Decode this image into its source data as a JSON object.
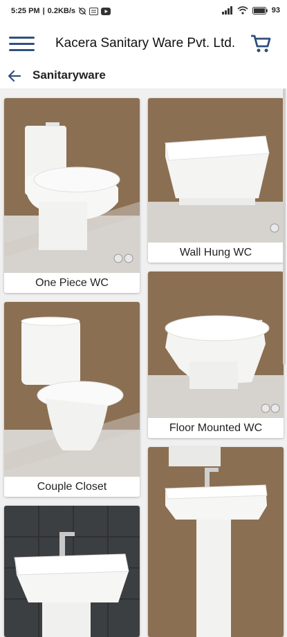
{
  "status": {
    "time": "5:25 PM",
    "speed": "0.2KB/s",
    "battery": "93"
  },
  "header": {
    "title": "Kacera Sanitary Ware Pvt. Ltd.",
    "menu_icon": "hamburger-menu-icon",
    "cart_icon": "shopping-cart-icon"
  },
  "subheader": {
    "title": "Sanitaryware",
    "back_icon": "back-arrow-icon"
  },
  "products": [
    {
      "name": "One Piece WC"
    },
    {
      "name": "Wall Hung WC"
    },
    {
      "name": "Couple Closet"
    },
    {
      "name": "Floor Mounted WC"
    },
    {
      "name": ""
    },
    {
      "name": ""
    }
  ],
  "colors": {
    "accent": "#2f4f7f",
    "wall_brown": "#8b6f52",
    "floor_grey": "#d6d2cd"
  }
}
